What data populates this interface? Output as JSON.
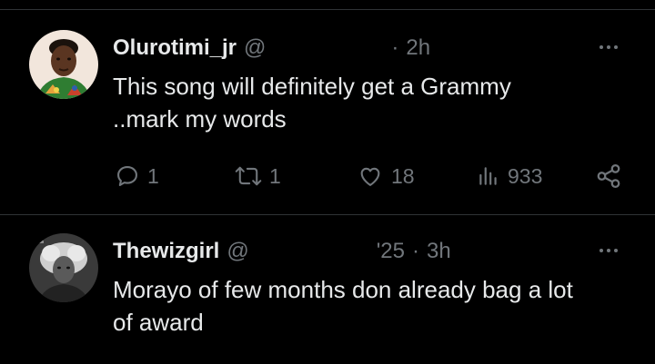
{
  "tweets": [
    {
      "display_name": "Olurotimi_jr",
      "handle": "@",
      "time": "2h",
      "text_line1": "This song will definitely get a Grammy",
      "text_line2": "..mark my words",
      "replies": "1",
      "reposts": "1",
      "likes": "18",
      "views": "933"
    },
    {
      "display_name": "Thewizgirl",
      "handle": "@",
      "date": "'25",
      "time": "3h",
      "text_line1": "Morayo of few months don already bag a lot",
      "text_line2": "of award"
    }
  ],
  "icons": {
    "reply": "reply-icon",
    "repost": "repost-icon",
    "like": "heart-icon",
    "views": "views-icon",
    "share": "share-icon",
    "more": "more-icon"
  },
  "colors": {
    "background": "#000000",
    "text": "#e7e9ea",
    "muted": "#71767b",
    "divider": "#2f3336"
  }
}
